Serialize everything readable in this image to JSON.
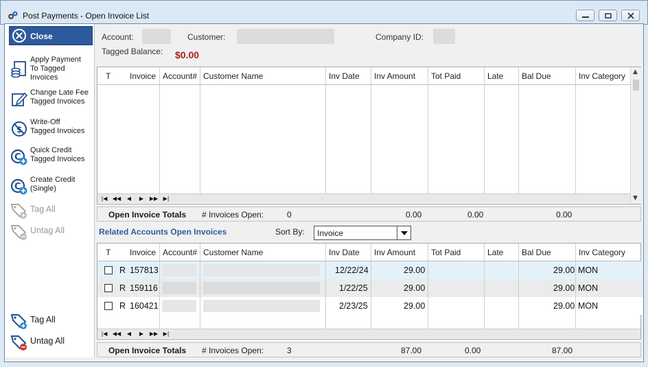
{
  "window": {
    "title": "Post Payments - Open Invoice List"
  },
  "sidebar": {
    "close_label": "Close",
    "actions": [
      {
        "label": "Apply Payment To Tagged Invoices",
        "lines": [
          "Apply Payment",
          "To Tagged",
          "Invoices"
        ],
        "icon": "apply-payment-icon"
      },
      {
        "label": "Change Late Fee Tagged Invoices",
        "lines": [
          "Change Late Fee",
          "Tagged Invoices"
        ],
        "icon": "edit-icon"
      },
      {
        "label": "Write-Off Tagged Invoices",
        "lines": [
          "Write-Off",
          "Tagged Invoices"
        ],
        "icon": "write-off-icon"
      },
      {
        "label": "Quick Credit Tagged Invoices",
        "lines": [
          "Quick Credit",
          "Tagged Invoices"
        ],
        "icon": "credit-add-icon"
      },
      {
        "label": "Create Credit (Single)",
        "lines": [
          "Create Credit",
          "(Single)"
        ],
        "icon": "credit-add-icon"
      }
    ],
    "tag_all_top": "Tag All",
    "untag_all_top": "Untag All",
    "tag_all_bottom": "Tag All",
    "untag_all_bottom": "Untag All"
  },
  "header": {
    "account_label": "Account:",
    "customer_label": "Customer:",
    "company_id_label": "Company ID:",
    "tagged_balance_label": "Tagged Balance:",
    "tagged_balance_value": "$0.00"
  },
  "columns": [
    "T",
    "Invoice",
    "Account#",
    "Customer Name",
    "Inv Date",
    "Inv Amount",
    "Tot Paid",
    "Late",
    "Bal Due",
    "Inv Category"
  ],
  "open_totals": {
    "label": "Open Invoice Totals",
    "count_label": "# Invoices Open:",
    "count": "0",
    "inv_amount": "0.00",
    "tot_paid": "0.00",
    "bal_due": "0.00"
  },
  "related": {
    "title": "Related Accounts Open Invoices",
    "sort_by_label": "Sort By:",
    "sort_by_value": "Invoice",
    "rows": [
      {
        "t": "R",
        "invoice": "157813",
        "inv_date": "12/22/24",
        "inv_amount": "29.00",
        "tot_paid": "",
        "late": "",
        "bal_due": "29.00",
        "category": "MON"
      },
      {
        "t": "R",
        "invoice": "159116",
        "inv_date": "1/22/25",
        "inv_amount": "29.00",
        "tot_paid": "",
        "late": "",
        "bal_due": "29.00",
        "category": "MON"
      },
      {
        "t": "R",
        "invoice": "160421",
        "inv_date": "2/23/25",
        "inv_amount": "29.00",
        "tot_paid": "",
        "late": "",
        "bal_due": "29.00",
        "category": "MON"
      }
    ],
    "totals": {
      "label": "Open Invoice Totals",
      "count_label": "# Invoices Open:",
      "count": "3",
      "inv_amount": "87.00",
      "tot_paid": "0.00",
      "bal_due": "87.00"
    }
  },
  "nav_buttons": [
    "|◀",
    "◀◀",
    "◀",
    "▶",
    "▶▶",
    "▶|"
  ],
  "colors": {
    "close_bg": "#2d5a9c",
    "balance": "#a3211b",
    "related_title": "#2f5d9e",
    "selected_row": "#e3f1fb"
  }
}
